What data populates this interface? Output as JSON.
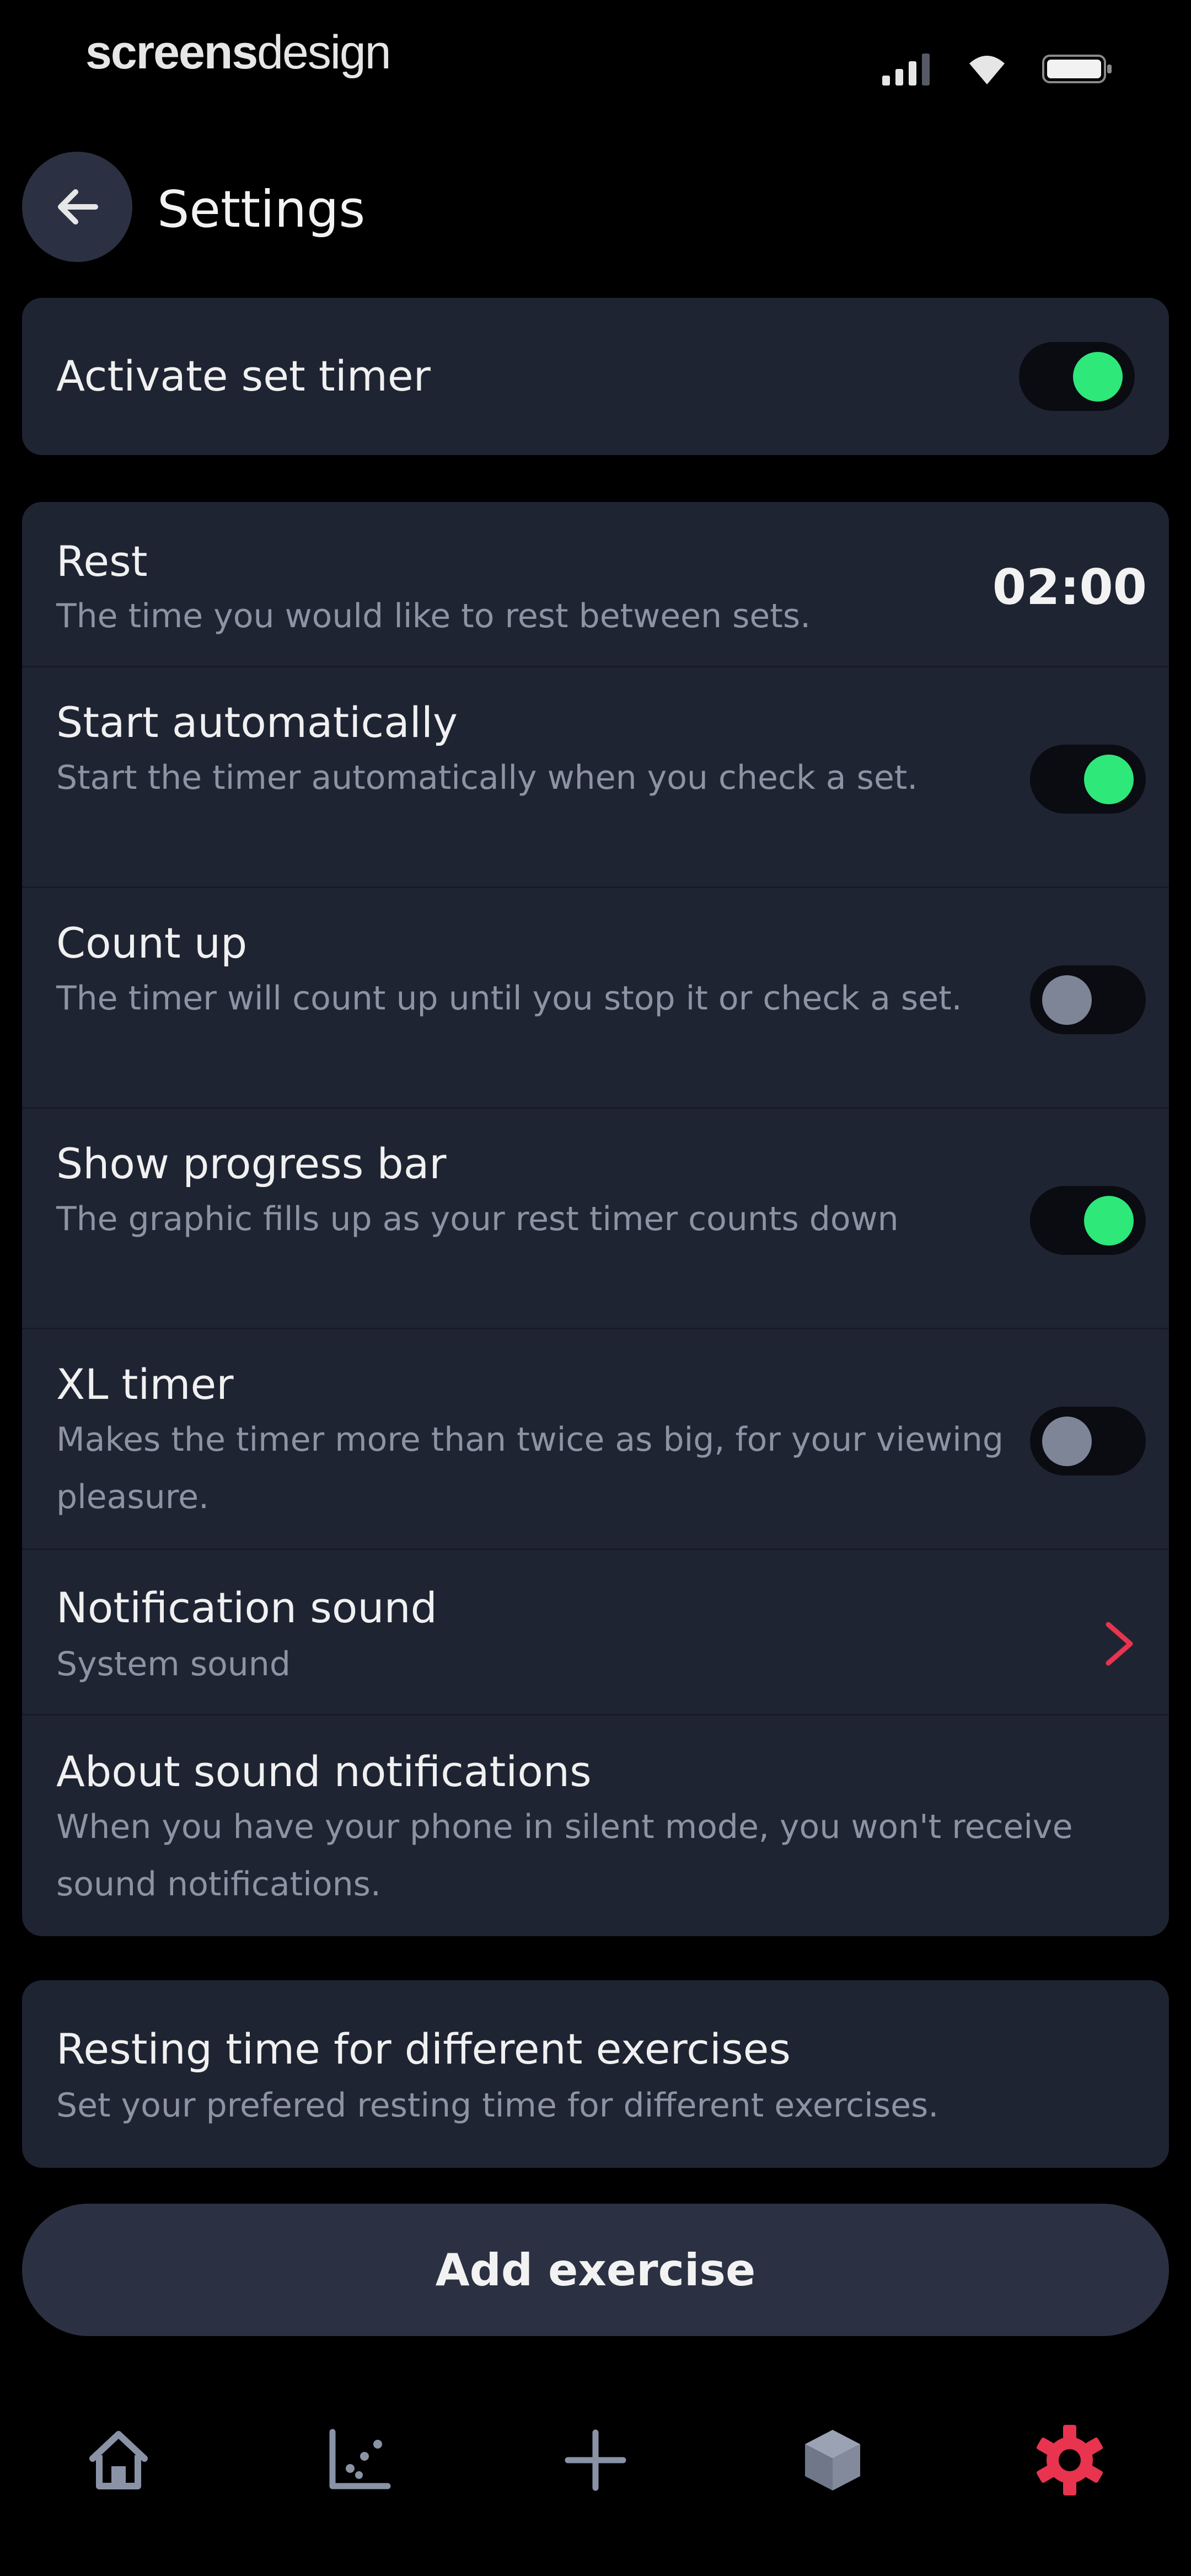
{
  "status_bar": {
    "brand_bold": "screens",
    "brand_light": "design"
  },
  "header": {
    "title": "Settings"
  },
  "timer_card": {
    "label": "Activate set timer",
    "enabled": true
  },
  "settings": {
    "rest": {
      "title": "Rest",
      "subtitle": "The time you would like to rest between sets.",
      "value": "02:00"
    },
    "start_automatically": {
      "title": "Start automatically",
      "subtitle": "Start the timer automatically when you check a set.",
      "enabled": true
    },
    "count_up": {
      "title": "Count up",
      "subtitle": "The timer will count up until you stop it or check a set.",
      "enabled": false
    },
    "show_progress_bar": {
      "title": "Show progress bar",
      "subtitle": "The graphic fills up as your rest timer counts down",
      "enabled": true
    },
    "xl_timer": {
      "title": "XL timer",
      "subtitle": "Makes the timer more than twice as big, for your viewing pleasure.",
      "enabled": false
    },
    "notification_sound": {
      "title": "Notification sound",
      "subtitle": "System sound"
    },
    "about_sound": {
      "title": "About sound notifications",
      "subtitle": "When you have your phone in silent mode, you won't receive sound notifications."
    }
  },
  "resting_card": {
    "title": "Resting time for different exercises",
    "subtitle": "Set your prefered resting time for different exercises."
  },
  "add_button": {
    "label": "Add exercise"
  },
  "colors": {
    "background": "#000000",
    "card": "#1f2433",
    "toggle_on": "#2ee879",
    "toggle_off_knob": "#7d8597",
    "accent_red": "#e8344e",
    "icon_gray": "#8a93a6"
  },
  "bottom_nav": {
    "items": [
      {
        "icon": "home-icon",
        "active": false
      },
      {
        "icon": "chart-icon",
        "active": false
      },
      {
        "icon": "plus-icon",
        "active": false
      },
      {
        "icon": "cube-icon",
        "active": false
      },
      {
        "icon": "gear-icon",
        "active": true
      }
    ]
  }
}
